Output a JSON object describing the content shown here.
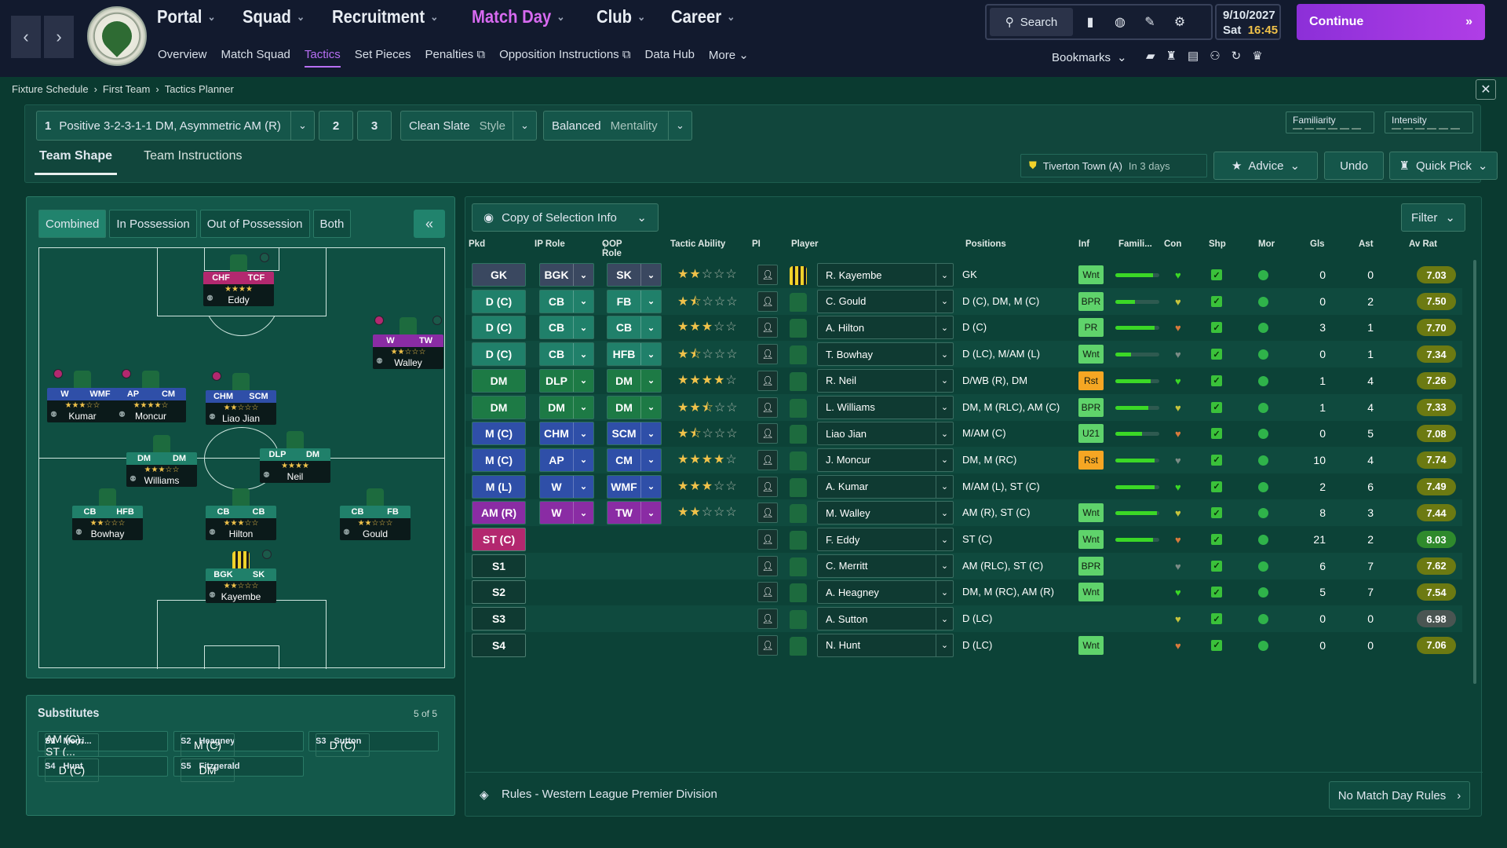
{
  "nav": {
    "main": [
      {
        "label": "Portal"
      },
      {
        "label": "Squad"
      },
      {
        "label": "Recruitment"
      },
      {
        "label": "Match Day",
        "active": true
      },
      {
        "label": "Club"
      },
      {
        "label": "Career"
      }
    ],
    "sub": [
      "Overview",
      "Match Squad",
      "Tactics",
      "Set Pieces",
      "Penalties",
      "Opposition Instructions",
      "Data Hub",
      "More"
    ],
    "search_label": "Search",
    "date": "9/10/2027",
    "day": "Sat",
    "time": "16:45",
    "continue_label": "Continue",
    "bookmarks_label": "Bookmarks"
  },
  "breadcrumb": [
    "Fixture Schedule",
    "First Team",
    "Tactics Planner"
  ],
  "tactic": {
    "slot": "1",
    "name": "Positive 3-2-3-1-1 DM, Asymmetric AM (R)",
    "slot2": "2",
    "slot3": "3",
    "style_value": "Clean Slate",
    "style_label": "Style",
    "mentality_value": "Balanced",
    "mentality_label": "Mentality",
    "familiarity_label": "Familiarity",
    "intensity_label": "Intensity",
    "tab_shape": "Team Shape",
    "tab_instructions": "Team Instructions",
    "fixture": "Tiverton Town (A)",
    "fixture_when": "In 3 days",
    "advice_label": "Advice",
    "undo_label": "Undo",
    "quickpick_label": "Quick Pick"
  },
  "pitch_view": {
    "tabs": [
      "Combined",
      "In Possession",
      "Out of Possession",
      "Both"
    ],
    "cards": [
      {
        "roles": [
          "CHF",
          "TCF"
        ],
        "stars": "★★★★",
        "name": "Eddy"
      },
      {
        "roles": [
          "W",
          "TW"
        ],
        "stars": "★★☆☆☆",
        "name": "Walley"
      },
      {
        "roles": [
          "W",
          "WMF"
        ],
        "stars": "★★★☆☆",
        "name": "Kumar"
      },
      {
        "roles": [
          "AP",
          "CM"
        ],
        "stars": "★★★★☆",
        "name": "Moncur"
      },
      {
        "roles": [
          "CHM",
          "SCM"
        ],
        "stars": "★★☆☆☆",
        "name": "Liao Jian"
      },
      {
        "roles": [
          "DM",
          "DM"
        ],
        "stars": "★★★☆☆",
        "name": "Williams"
      },
      {
        "roles": [
          "DLP",
          "DM"
        ],
        "stars": "★★★★",
        "name": "Neil"
      },
      {
        "roles": [
          "CB",
          "HFB"
        ],
        "stars": "★★☆☆☆",
        "name": "Bowhay"
      },
      {
        "roles": [
          "CB",
          "CB"
        ],
        "stars": "★★★☆☆",
        "name": "Hilton"
      },
      {
        "roles": [
          "CB",
          "FB"
        ],
        "stars": "★★☆☆☆",
        "name": "Gould"
      },
      {
        "roles": [
          "BGK",
          "SK"
        ],
        "stars": "★★☆☆☆",
        "name": "Kayembe"
      }
    ]
  },
  "subs": {
    "title": "Substitutes",
    "count": "5 of 5",
    "items": [
      {
        "slot": "S1",
        "name": "Merri...",
        "pos": "AM (C), ST (..."
      },
      {
        "slot": "S2",
        "name": "Heagney",
        "pos": "M (C)"
      },
      {
        "slot": "S3",
        "name": "Sutton",
        "pos": "D (C)"
      },
      {
        "slot": "S4",
        "name": "Hunt",
        "pos": "D (C)"
      },
      {
        "slot": "S5",
        "name": "Fitzgerald",
        "pos": "DM"
      }
    ]
  },
  "table": {
    "copy_label": "Copy of Selection Info",
    "filter_label": "Filter",
    "headers": [
      "Pkd",
      "IP Role",
      "OOP Role",
      "Tactic Ability",
      "PI",
      "Player",
      "Positions",
      "Inf",
      "Famili...",
      "Con",
      "Shp",
      "Mor",
      "Gls",
      "Ast",
      "Av Rat"
    ],
    "rows": [
      {
        "pkd": "GK",
        "ip": "BGK",
        "oop": "SK",
        "stars": 2,
        "player": "R. Kayembe",
        "positions": "GK",
        "inf": "Wnt",
        "fam": 0.85,
        "gls": "0",
        "ast": "0",
        "rat": "7.03"
      },
      {
        "pkd": "D (C)",
        "ip": "CB",
        "oop": "FB",
        "stars": 1.5,
        "player": "C. Gould",
        "positions": "D (C), DM, M (C)",
        "inf": "BPR",
        "fam": 0.45,
        "gls": "0",
        "ast": "2",
        "rat": "7.50"
      },
      {
        "pkd": "D (C)",
        "ip": "CB",
        "oop": "CB",
        "stars": 3,
        "player": "A. Hilton",
        "positions": "D (C)",
        "inf": "PR",
        "fam": 0.9,
        "gls": "3",
        "ast": "1",
        "rat": "7.70"
      },
      {
        "pkd": "D (C)",
        "ip": "CB",
        "oop": "HFB",
        "stars": 1.5,
        "player": "T. Bowhay",
        "positions": "D (LC), M/AM (L)",
        "inf": "Wnt",
        "fam": 0.35,
        "gls": "0",
        "ast": "1",
        "rat": "7.34"
      },
      {
        "pkd": "DM",
        "ip": "DLP",
        "oop": "DM",
        "stars": 4,
        "player": "R. Neil",
        "positions": "D/WB (R), DM",
        "inf": "Rst",
        "fam": 0.8,
        "gls": "1",
        "ast": "4",
        "rat": "7.26"
      },
      {
        "pkd": "DM",
        "ip": "DM",
        "oop": "DM",
        "stars": 2.5,
        "player": "L. Williams",
        "positions": "DM, M (RLC), AM (C)",
        "inf": "BPR",
        "fam": 0.75,
        "gls": "1",
        "ast": "4",
        "rat": "7.33"
      },
      {
        "pkd": "M (C)",
        "ip": "CHM",
        "oop": "SCM",
        "stars": 1.5,
        "player": "Liao Jian",
        "positions": "M/AM (C)",
        "inf": "U21",
        "fam": 0.6,
        "gls": "0",
        "ast": "5",
        "rat": "7.08"
      },
      {
        "pkd": "M (C)",
        "ip": "AP",
        "oop": "CM",
        "stars": 4,
        "player": "J. Moncur",
        "positions": "DM, M (RC)",
        "inf": "Rst",
        "fam": 0.9,
        "gls": "10",
        "ast": "4",
        "rat": "7.74"
      },
      {
        "pkd": "M (L)",
        "ip": "W",
        "oop": "WMF",
        "stars": 3,
        "player": "A. Kumar",
        "positions": "M/AM (L), ST (C)",
        "inf": "",
        "fam": 0.9,
        "gls": "2",
        "ast": "6",
        "rat": "7.49"
      },
      {
        "pkd": "AM (R)",
        "ip": "W",
        "oop": "TW",
        "stars": 2,
        "player": "M. Walley",
        "positions": "AM (R), ST (C)",
        "inf": "Wnt",
        "fam": 0.95,
        "gls": "8",
        "ast": "3",
        "rat": "7.44"
      },
      {
        "pkd": "ST (C)",
        "ip": "CHF",
        "oop": "TCF",
        "stars": 4,
        "player": "F. Eddy",
        "positions": "ST (C)",
        "inf": "Wnt",
        "fam": 0.85,
        "gls": "21",
        "ast": "2",
        "rat": "8.03"
      },
      {
        "pkd": "S1",
        "ip": "",
        "oop": "",
        "stars": 0,
        "player": "C. Merritt",
        "positions": "AM (RLC), ST (C)",
        "inf": "BPR",
        "fam": 0,
        "gls": "6",
        "ast": "7",
        "rat": "7.62"
      },
      {
        "pkd": "S2",
        "ip": "",
        "oop": "",
        "stars": 0,
        "player": "A. Heagney",
        "positions": "DM, M (RC), AM (R)",
        "inf": "Wnt",
        "fam": 0,
        "gls": "5",
        "ast": "7",
        "rat": "7.54"
      },
      {
        "pkd": "S3",
        "ip": "",
        "oop": "",
        "stars": 0,
        "player": "A. Sutton",
        "positions": "D (LC)",
        "inf": "",
        "fam": 0,
        "gls": "0",
        "ast": "0",
        "rat": "6.98"
      },
      {
        "pkd": "S4",
        "ip": "",
        "oop": "",
        "stars": 0,
        "player": "N. Hunt",
        "positions": "D (LC)",
        "inf": "Wnt",
        "fam": 0,
        "gls": "0",
        "ast": "0",
        "rat": "7.06"
      }
    ],
    "rules_label": "Rules - Western League Premier Division",
    "no_rules_label": "No Match Day Rules"
  },
  "colors": {
    "gk": "#3a4860",
    "def": "#20806a",
    "dm": "#1d7a45",
    "mid": "#2f4fa8",
    "amr": "#8a2ca4",
    "st": "#b3286f",
    "sub": "#0f3a32",
    "inf_wnt": "#5fd36b",
    "inf_bpr": "#5fd36b",
    "inf_pr": "#5fd36b",
    "inf_rst": "#f5a623",
    "inf_u21": "#5fd36b"
  }
}
